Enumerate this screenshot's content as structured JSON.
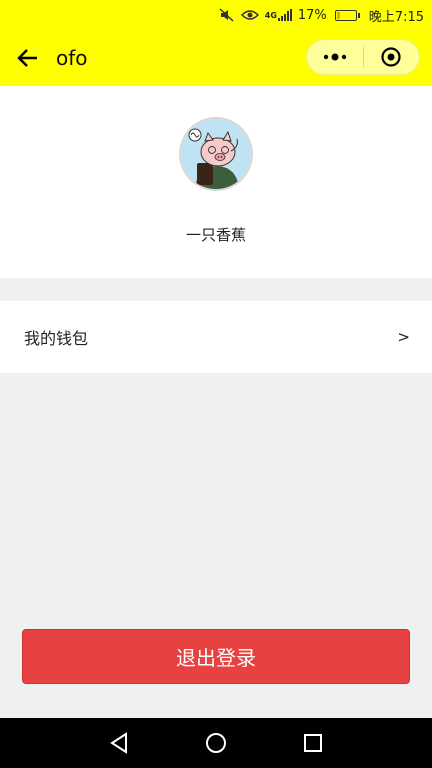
{
  "status_bar": {
    "network": "4G",
    "battery_percent": "17%",
    "time": "晚上7:15",
    "battery_level": 0.17
  },
  "title_bar": {
    "title": "ofo"
  },
  "profile": {
    "nickname": "一只香蕉"
  },
  "menu": {
    "wallet_label": "我的钱包",
    "wallet_arrow": ">"
  },
  "logout": {
    "label": "退出登录"
  },
  "colors": {
    "header": "#ffff00",
    "logout": "#e84141",
    "background": "#f0f0f0"
  }
}
